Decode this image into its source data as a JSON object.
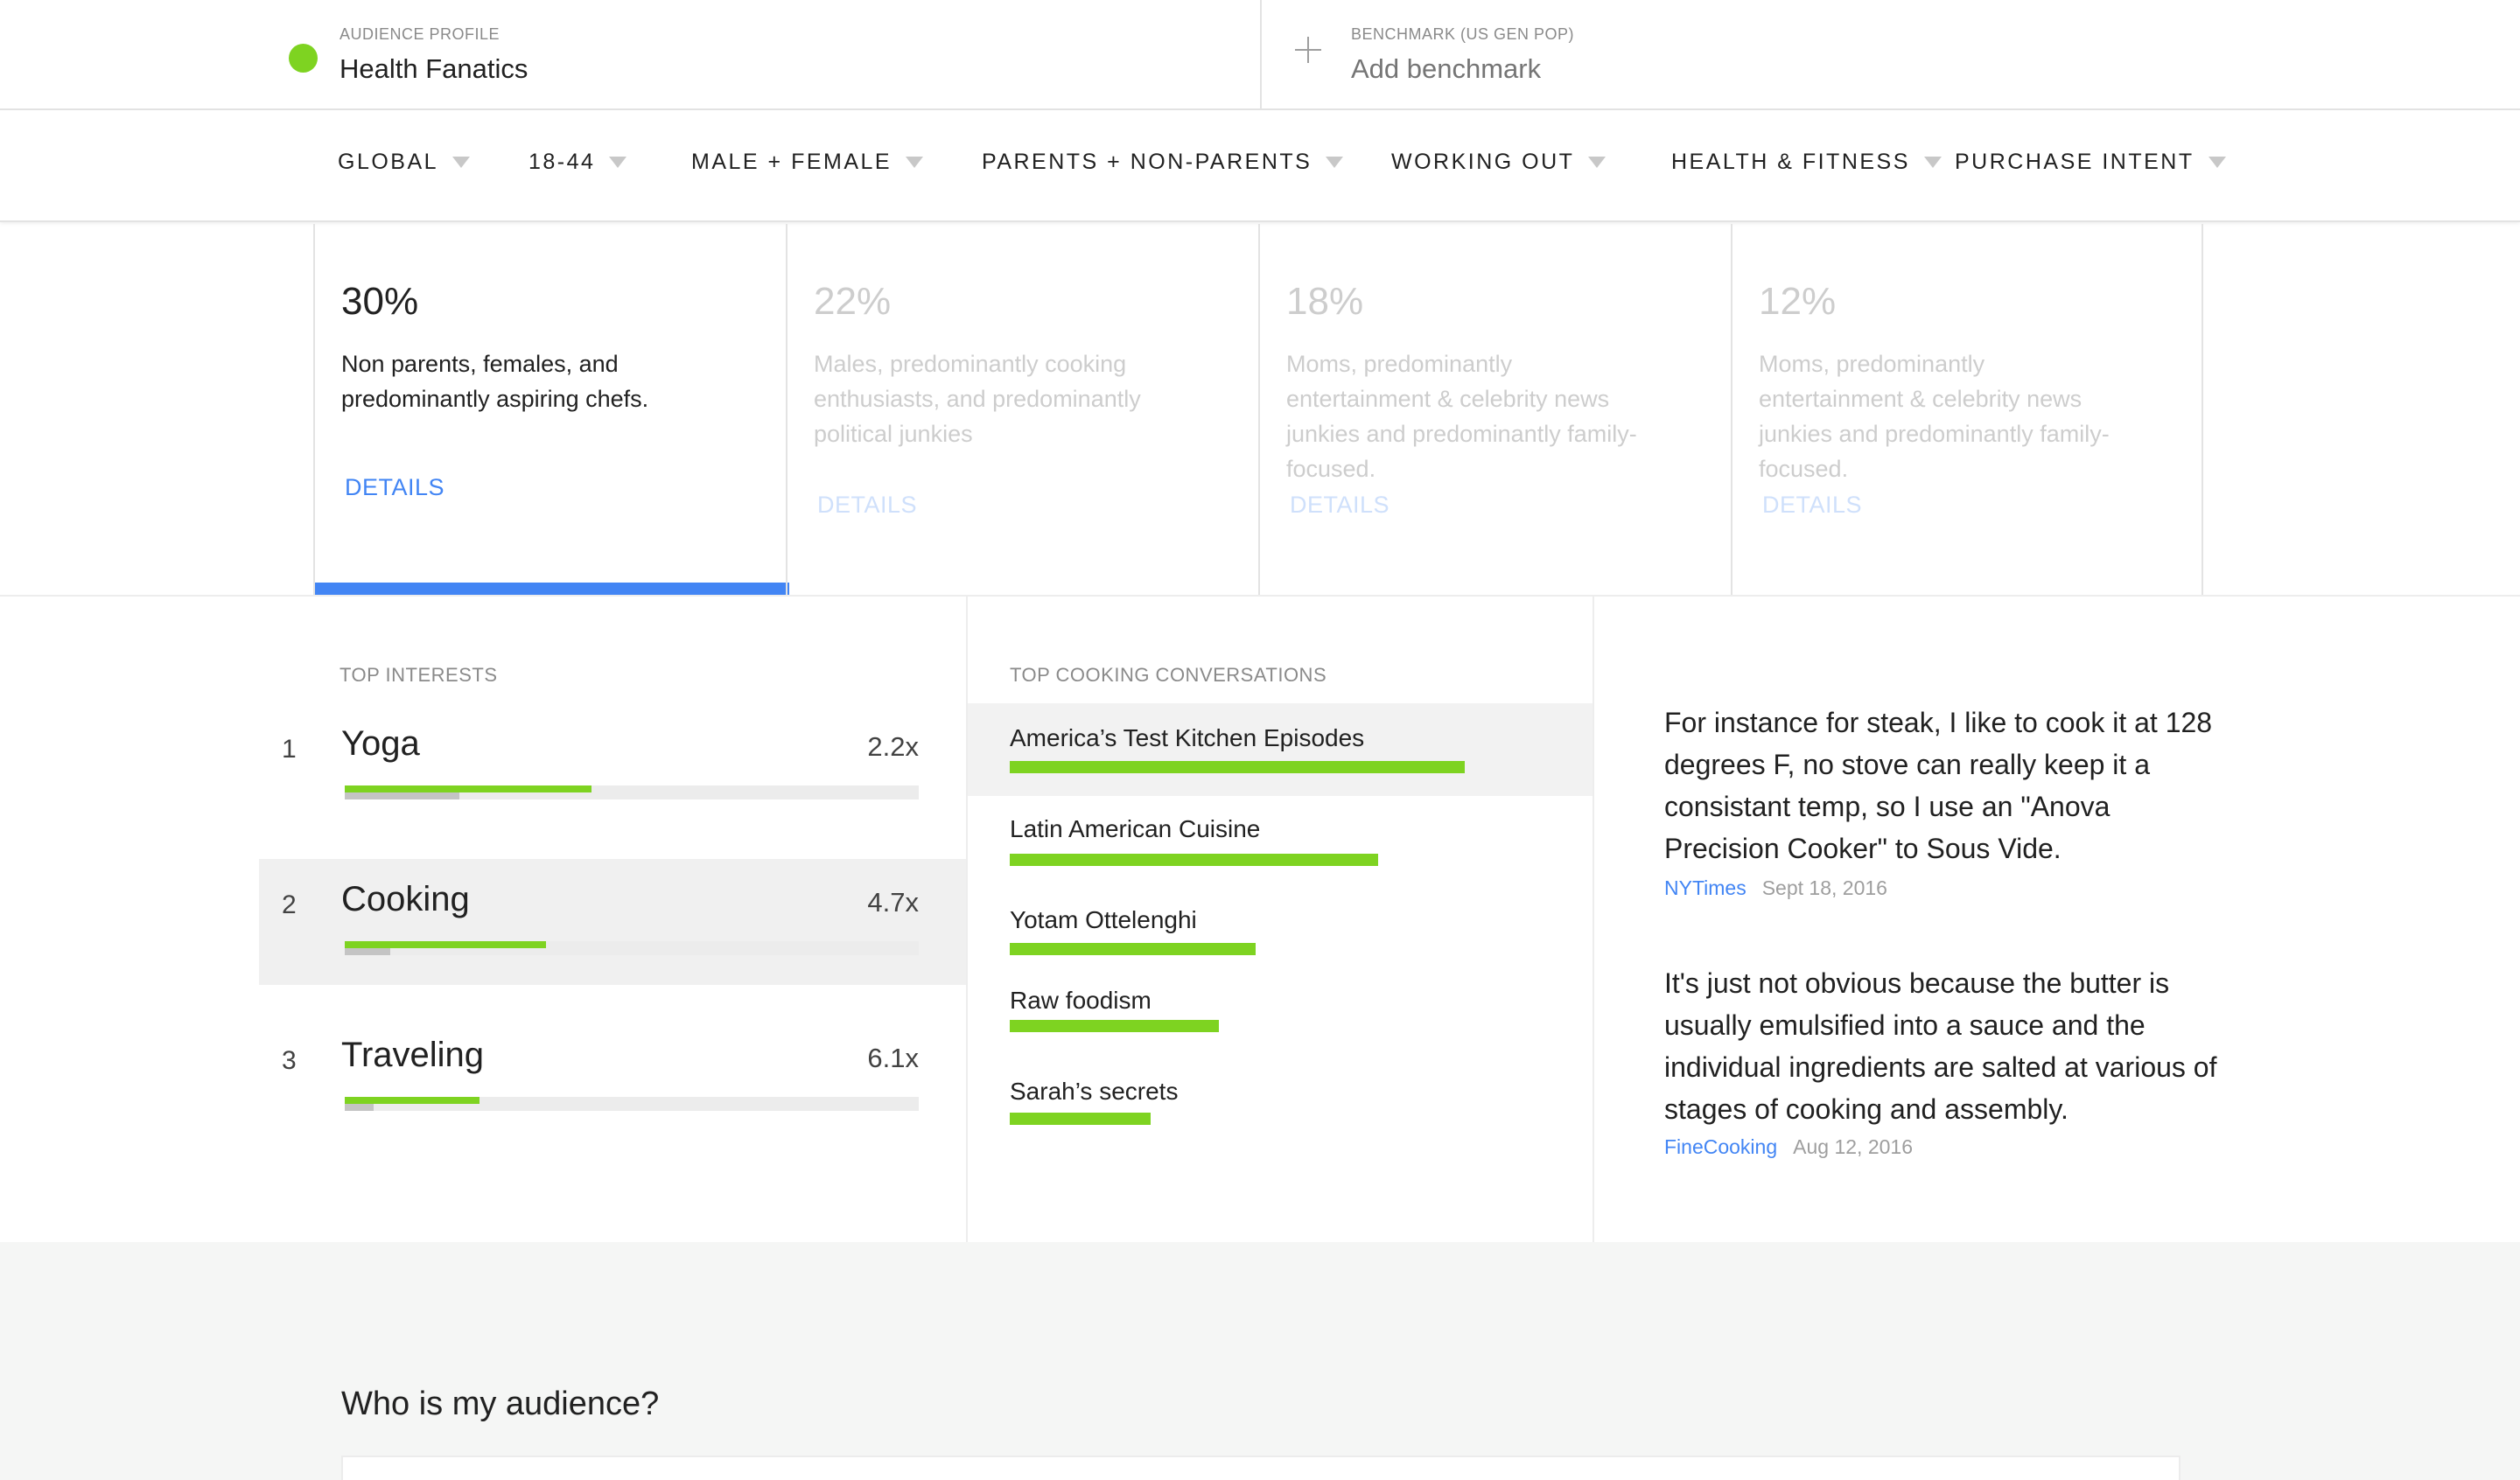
{
  "header": {
    "profile_label": "AUDIENCE PROFILE",
    "profile_title": "Health Fanatics",
    "benchmark_label": "BENCHMARK (US GEN POP)",
    "benchmark_action": "Add benchmark",
    "profile_color": "#7ed321"
  },
  "filters": [
    "GLOBAL",
    "18-44",
    "MALE + FEMALE",
    "PARENTS + NON-PARENTS",
    "WORKING OUT",
    "HEALTH & FITNESS",
    "PURCHASE INTENT"
  ],
  "segments": [
    {
      "pct": "30%",
      "desc": "Non parents, females, and predominantly aspiring chefs.",
      "details": "DETAILS",
      "selected": true
    },
    {
      "pct": "22%",
      "desc": "Males, predominantly cooking enthusiasts, and predominantly political junkies",
      "details": "DETAILS",
      "selected": false
    },
    {
      "pct": "18%",
      "desc": "Moms, predominantly entertainment & celebrity news junkies and predominantly family-focused.",
      "details": "DETAILS",
      "selected": false
    },
    {
      "pct": "12%",
      "desc": "Moms, predominantly entertainment & celebrity news junkies and predominantly family-focused.",
      "details": "DETAILS",
      "selected": false
    }
  ],
  "top_interests": {
    "label": "TOP INTERESTS",
    "items": [
      {
        "rank": "1",
        "name": "Yoga",
        "index": "2.2x",
        "audience_share": 0.43,
        "baseline_share": 0.2
      },
      {
        "rank": "2",
        "name": "Cooking",
        "index": "4.7x",
        "audience_share": 0.35,
        "baseline_share": 0.08
      },
      {
        "rank": "3",
        "name": "Traveling",
        "index": "6.1x",
        "audience_share": 0.235,
        "baseline_share": 0.05
      }
    ]
  },
  "top_conversations": {
    "label": "TOP COOKING CONVERSATIONS",
    "items": [
      {
        "name": "America’s Test Kitchen Episodes",
        "share": 1.0
      },
      {
        "name": "Latin American Cuisine",
        "share": 0.81
      },
      {
        "name": "Yotam Ottelenghi",
        "share": 0.54
      },
      {
        "name": "Raw foodism",
        "share": 0.46
      },
      {
        "name": "Sarah’s secrets",
        "share": 0.31
      }
    ]
  },
  "quotes": [
    {
      "text": "For instance for steak, I like to cook it at 128 degrees F, no stove can really keep it a consistant temp, so I use an \"Anova Precision Cooker\" to Sous Vide.",
      "source": "NYTimes",
      "date": "Sept 18, 2016"
    },
    {
      "text": "It's just not obvious because the butter is usually emulsified into a sauce and the individual ingredients are salted at various of stages of cooking and assembly.",
      "source": "FineCooking",
      "date": "Aug 12, 2016"
    }
  ],
  "bottom": {
    "heading": "Who is my audience?"
  },
  "colors": {
    "accent_blue": "#4285f4",
    "accent_green": "#7ed321"
  }
}
